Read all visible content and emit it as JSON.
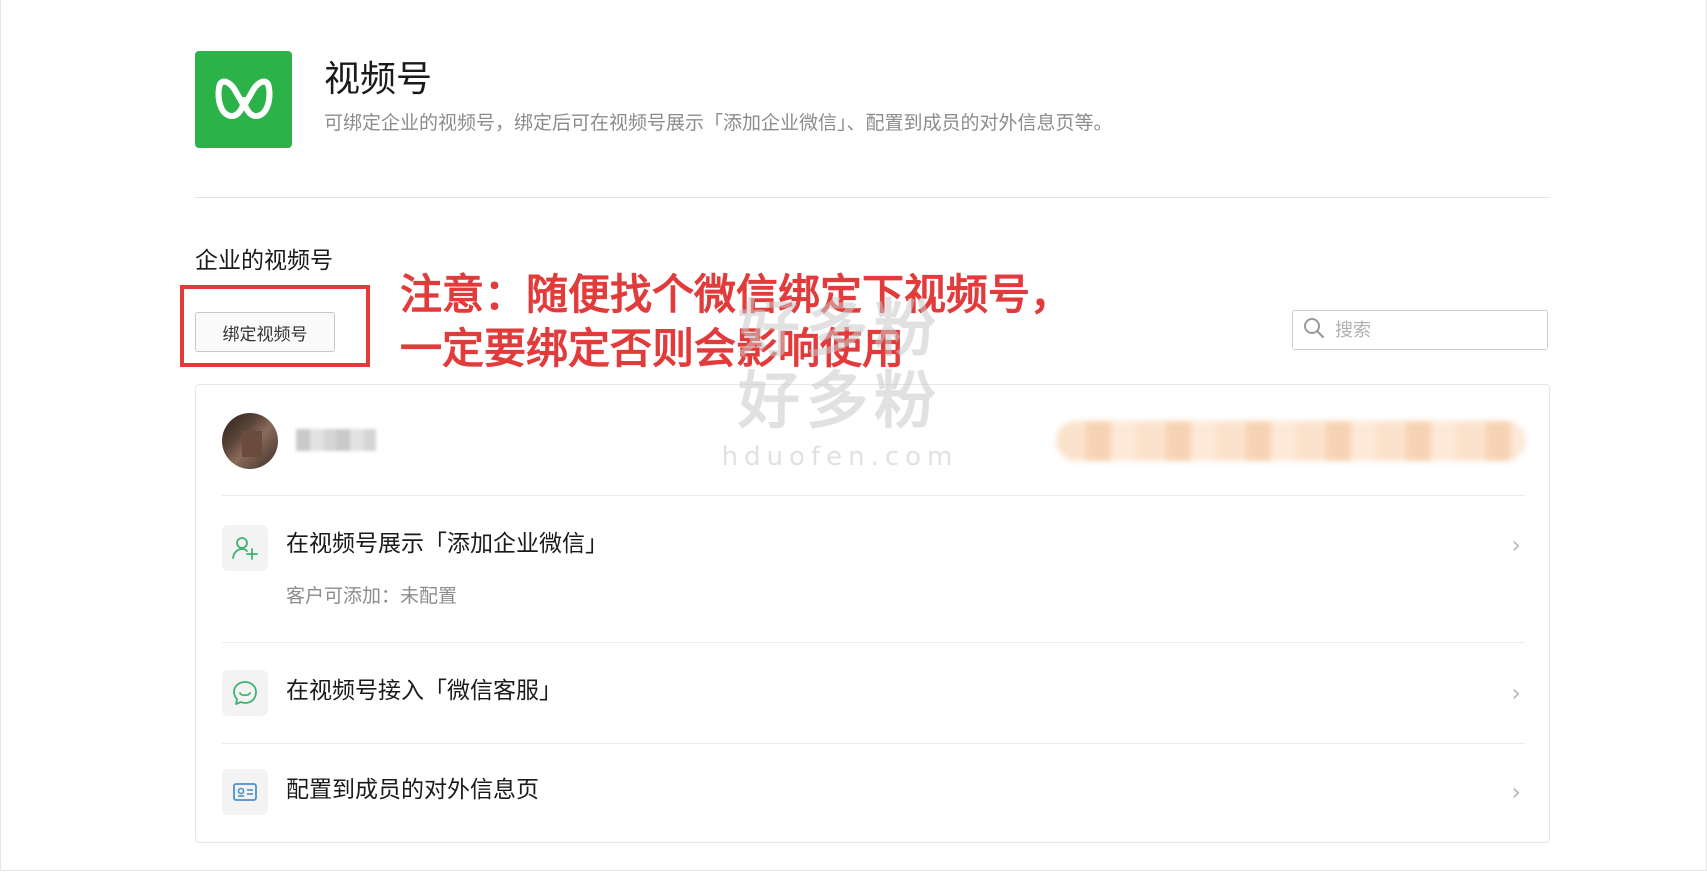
{
  "app": {
    "title": "视频号",
    "description": "可绑定企业的视频号，绑定后可在视频号展示「添加企业微信」、配置到成员的对外信息页等。",
    "logo_icon": "channels-logo-icon",
    "brand_color": "#2bb34a"
  },
  "section": {
    "title": "企业的视频号",
    "bind_button_label": "绑定视频号"
  },
  "annotation": {
    "line1": "注意：随便找个微信绑定下视频号，",
    "line2": "一定要绑定否则会影响使用",
    "color": "#e23b3b"
  },
  "search": {
    "placeholder": "搜索",
    "value": ""
  },
  "account": {
    "avatar_icon": "avatar"
  },
  "rows": [
    {
      "title": "在视频号展示「添加企业微信」",
      "subtitle": "客户可添加：未配置",
      "icon": "add-contact-icon"
    },
    {
      "title": "在视频号接入「微信客服」",
      "subtitle": "",
      "icon": "customer-service-icon"
    },
    {
      "title": "配置到成员的对外信息页",
      "subtitle": "",
      "icon": "id-card-icon"
    }
  ],
  "watermark": {
    "big": "好多粉",
    "small": "hduofen.com"
  }
}
